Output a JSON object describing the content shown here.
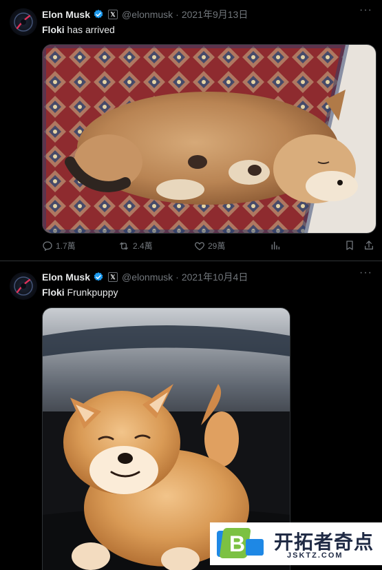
{
  "tweets": [
    {
      "author_name": "Elon Musk",
      "handle": "@elonmusk",
      "date": "2021年9月13日",
      "bold_text": "Floki",
      "text": " has arrived",
      "stats": {
        "replies": "1.7萬",
        "retweets": "2.4萬",
        "likes": "29萬"
      }
    },
    {
      "author_name": "Elon Musk",
      "handle": "@elonmusk",
      "date": "2021年10月4日",
      "bold_text": "Floki",
      "text": " Frunkpuppy"
    }
  ],
  "dot_separator": "·",
  "more_label": "···",
  "x_badge": "𝕏",
  "watermark": {
    "title": "开拓者奇点",
    "url": "JSKTZ.COM"
  },
  "colors": {
    "background": "#000000",
    "muted": "#71767b",
    "verified": "#1d9bf0"
  },
  "icons": [
    "avatar-image",
    "verified-icon",
    "x-affiliation-icon",
    "more-icon",
    "reply-icon",
    "retweet-icon",
    "like-icon",
    "views-icon",
    "bookmark-icon",
    "share-icon"
  ]
}
